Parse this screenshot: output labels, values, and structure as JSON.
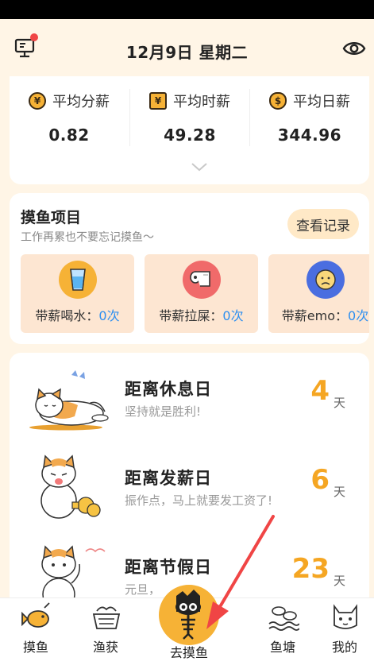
{
  "header": {
    "date_title": "12月9日 星期二",
    "left_icon": "monitor-icon",
    "right_icon": "eye-icon"
  },
  "salary": [
    {
      "label": "平均分薪",
      "value": "0.82",
      "icon": "yen-coin-icon",
      "coin_glyph": "¥"
    },
    {
      "label": "平均时薪",
      "value": "49.28",
      "icon": "wallet-icon",
      "coin_glyph": "¥"
    },
    {
      "label": "平均日薪",
      "value": "344.96",
      "icon": "money-bag-icon",
      "coin_glyph": "$"
    }
  ],
  "fish_project": {
    "title": "摸鱼项目",
    "subtitle": "工作再累也不要忘记摸鱼～",
    "record_button": "查看记录",
    "items": [
      {
        "label": "带薪喝水：",
        "count": "0次",
        "icon": "water-glass-icon",
        "color": "#f6b236"
      },
      {
        "label": "带薪拉屎：",
        "count": "0次",
        "icon": "toilet-paper-icon",
        "color": "#f06a6a"
      },
      {
        "label": "带薪emo：",
        "count": "0次",
        "icon": "sad-face-icon",
        "color": "#4a6ee0"
      }
    ]
  },
  "countdowns": [
    {
      "title": "距离休息日",
      "subtitle": "坚持就是胜利!",
      "number": "4",
      "unit": "天"
    },
    {
      "title": "距离发薪日",
      "subtitle": "振作点，马上就要发工资了!",
      "number": "6",
      "unit": "天"
    },
    {
      "title": "距离节假日",
      "subtitle": "元旦，",
      "number": "23",
      "unit": "天"
    }
  ],
  "tabs": [
    {
      "label": "摸鱼",
      "icon": "fish-icon"
    },
    {
      "label": "渔获",
      "icon": "fish-basket-icon"
    },
    {
      "label": "去摸鱼",
      "icon": "fish-bone-cat-icon"
    },
    {
      "label": "鱼塘",
      "icon": "fish-pond-icon"
    },
    {
      "label": "我的",
      "icon": "cat-face-icon"
    }
  ],
  "colors": {
    "background": "#fff5e6",
    "accent": "#f5a623",
    "count_blue": "#2d8ff0",
    "annotation_red": "#f04545"
  }
}
